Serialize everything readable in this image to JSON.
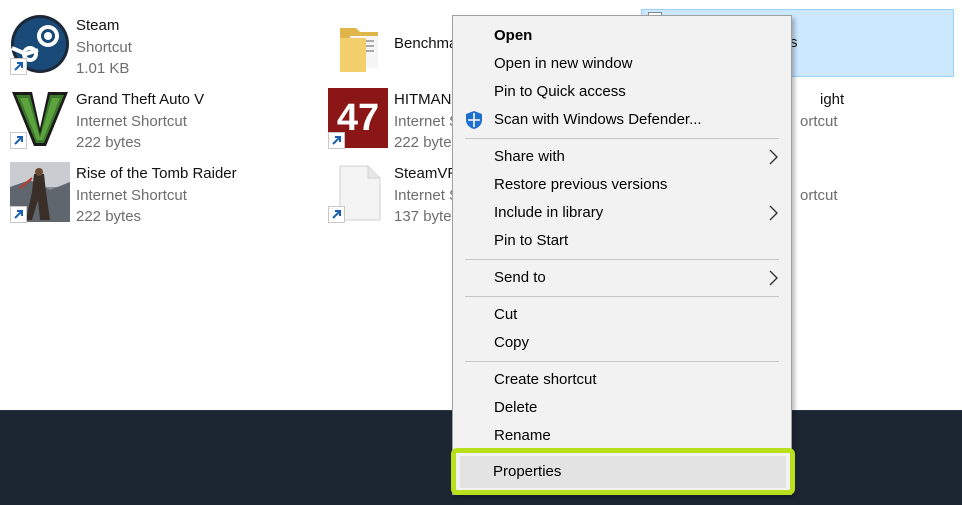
{
  "files": [
    {
      "name": "Steam",
      "type": "Shortcut",
      "size": "1.01 KB",
      "icon": "steam-logo"
    },
    {
      "name": "Grand Theft Auto V",
      "type": "Internet Shortcut",
      "size": "222 bytes",
      "icon": "gta-logo"
    },
    {
      "name": "Rise of the Tomb Raider",
      "type": "Internet Shortcut",
      "size": "222 bytes",
      "icon": "tomb-raider-thumbnail"
    },
    {
      "name": "Benchma",
      "type": "",
      "size": "",
      "icon": "folder-icon"
    },
    {
      "name": "HITMAN",
      "type": "Internet S",
      "size": "222 byte",
      "icon": "hitman-logo",
      "badge": "47"
    },
    {
      "name": "SteamVR",
      "type": "Internet S",
      "size": "137 byte",
      "icon": "blank-file-icon"
    },
    {
      "name": "s",
      "type": "",
      "size": "",
      "icon": "selected-file"
    },
    {
      "name": "ight",
      "type": "ortcut",
      "size": "",
      "icon": ""
    },
    {
      "name": "",
      "type": "ortcut",
      "size": "",
      "icon": ""
    }
  ],
  "context_menu": {
    "open": "Open",
    "open_new_window": "Open in new window",
    "pin_quick_access": "Pin to Quick access",
    "scan_defender": "Scan with Windows Defender...",
    "share_with": "Share with",
    "restore_previous": "Restore previous versions",
    "include_library": "Include in library",
    "pin_start": "Pin to Start",
    "send_to": "Send to",
    "cut": "Cut",
    "copy": "Copy",
    "create_shortcut": "Create shortcut",
    "delete": "Delete",
    "rename": "Rename",
    "properties": "Properties"
  },
  "colors": {
    "highlight": "#b8e01c",
    "selection": "#cce8ff",
    "taskbar": "#1c2633"
  }
}
